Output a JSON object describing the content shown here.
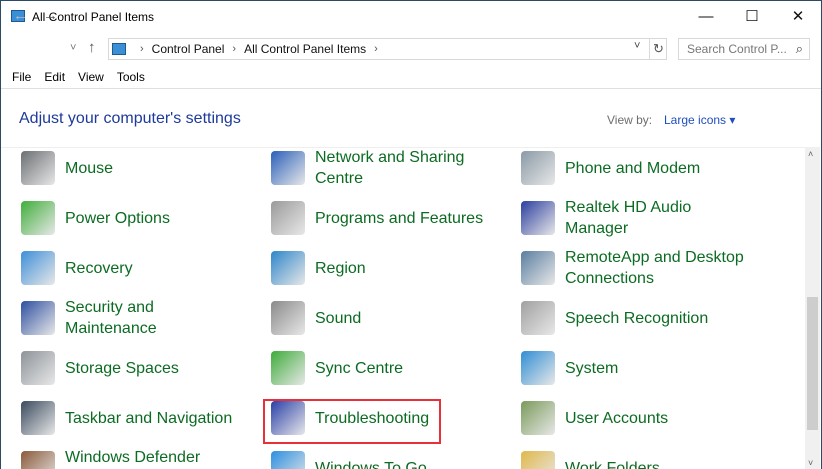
{
  "window": {
    "title": "All Control Panel Items",
    "minimize": "—",
    "maximize": "☐",
    "close": "✕"
  },
  "nav": {
    "back": "←",
    "forward": "→",
    "recent": "˅",
    "up": "↑",
    "breadcrumb": [
      "Control Panel",
      "All Control Panel Items"
    ],
    "dropdown": "˅",
    "refresh": "↻",
    "search_placeholder": "Search Control P...",
    "search_icon": "⌕"
  },
  "menu": [
    "File",
    "Edit",
    "View",
    "Tools"
  ],
  "main": {
    "heading": "Adjust your computer's settings",
    "view_by_label": "View by:",
    "view_by_value": "Large icons ▾"
  },
  "items": [
    {
      "label": "Mouse",
      "color": "#6b6f73"
    },
    {
      "label": "Network and Sharing Centre",
      "color": "#2a5fb8"
    },
    {
      "label": "Phone and Modem",
      "color": "#8a9aa6"
    },
    {
      "label": "Power Options",
      "color": "#3fae3a"
    },
    {
      "label": "Programs and Features",
      "color": "#9a9a9a"
    },
    {
      "label": "Realtek HD Audio Manager",
      "color": "#2b3e9e"
    },
    {
      "label": "Recovery",
      "color": "#3d8fd8"
    },
    {
      "label": "Region",
      "color": "#2c86c9"
    },
    {
      "label": "RemoteApp and Desktop Connections",
      "color": "#5a7ea0"
    },
    {
      "label": "Security and Maintenance",
      "color": "#2e4fa0"
    },
    {
      "label": "Sound",
      "color": "#8a8a8a"
    },
    {
      "label": "Speech Recognition",
      "color": "#a0a0a0"
    },
    {
      "label": "Storage Spaces",
      "color": "#8d9399"
    },
    {
      "label": "Sync Centre",
      "color": "#3eac3a"
    },
    {
      "label": "System",
      "color": "#2e8ed4"
    },
    {
      "label": "Taskbar and Navigation",
      "color": "#3a4a5e"
    },
    {
      "label": "Troubleshooting",
      "color": "#2a3fa8"
    },
    {
      "label": "User Accounts",
      "color": "#7a9a5a"
    },
    {
      "label": "Windows Defender Firewall",
      "color": "#8a5a3a"
    },
    {
      "label": "Windows To Go",
      "color": "#2c8fe0"
    },
    {
      "label": "Work Folders",
      "color": "#e0b84a"
    }
  ]
}
